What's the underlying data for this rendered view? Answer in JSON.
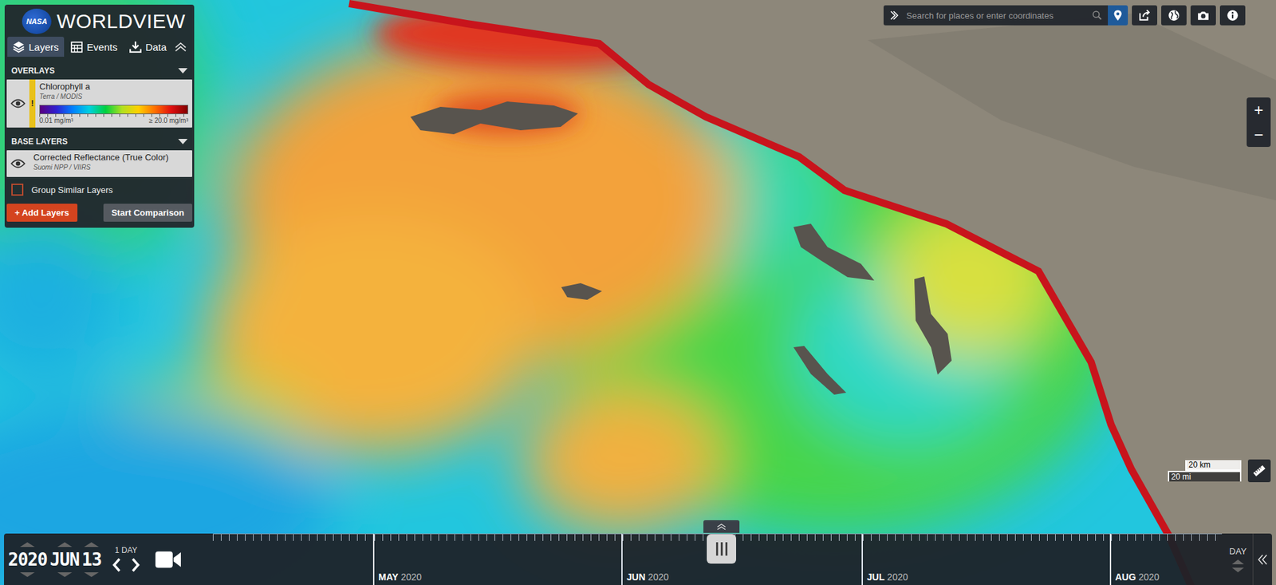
{
  "app": {
    "logo": "NASA",
    "title": "WORLDVIEW"
  },
  "tabs": [
    {
      "label": "Layers",
      "selected": true
    },
    {
      "label": "Events",
      "selected": false
    },
    {
      "label": "Data",
      "selected": false
    }
  ],
  "sections": [
    {
      "title": "OVERLAYS",
      "layers": [
        {
          "name": "Chlorophyll a",
          "source": "Terra / MODIS",
          "visible": true,
          "warning": "!",
          "legend": {
            "min": "0.01 mg/m³",
            "max": "≥ 20.0 mg/m³"
          }
        }
      ]
    },
    {
      "title": "BASE LAYERS",
      "layers": [
        {
          "name": "Corrected Reflectance (True Color)",
          "source": "Suomi NPP / VIIRS",
          "visible": true
        }
      ]
    }
  ],
  "group_similar": {
    "label": "Group Similar Layers",
    "checked": false
  },
  "buttons": {
    "add": "+ Add Layers",
    "compare": "Start Comparison"
  },
  "search": {
    "placeholder": "Search for places or enter coordinates"
  },
  "zoom": {
    "in": "+",
    "out": "−"
  },
  "scale": {
    "metric": "20 km",
    "imperial": "20 mi"
  },
  "date": {
    "year": "2020",
    "month": "JUN",
    "day": "13",
    "interval": "1 DAY"
  },
  "timeline": {
    "lead_days": 20,
    "zoom_level": "DAY",
    "months": [
      {
        "name": "MAY",
        "year": "2020",
        "days": 31,
        "selected": false
      },
      {
        "name": "JUN",
        "year": "2020",
        "days": 30,
        "selected": true
      },
      {
        "name": "JUL",
        "year": "2020",
        "days": 31,
        "selected": false
      },
      {
        "name": "AUG",
        "year": "2020",
        "days": 14,
        "selected": false
      }
    ]
  }
}
